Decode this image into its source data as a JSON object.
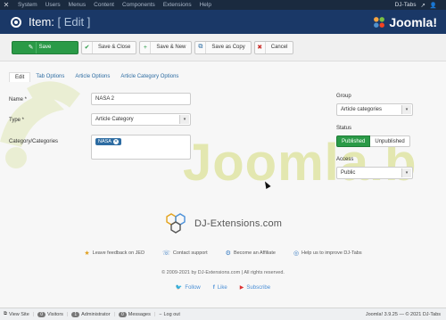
{
  "topnav": {
    "menu": [
      "System",
      "Users",
      "Menus",
      "Content",
      "Components",
      "Extensions",
      "Help"
    ],
    "site_name": "DJ-Tabs"
  },
  "titlebar": {
    "prefix": "Item:",
    "edit": "[ Edit ]",
    "brand": "Joomla!"
  },
  "toolbar": {
    "save": "Save",
    "save_close": "Save & Close",
    "save_new": "Save & New",
    "save_copy": "Save as Copy",
    "cancel": "Cancel"
  },
  "tabs": [
    "Edit",
    "Tab Options",
    "Article Options",
    "Article Category Options"
  ],
  "form": {
    "name_label": "Name *",
    "name_value": "NASA 2",
    "type_label": "Type *",
    "type_value": "Article Category",
    "categories_label": "Category/Categories",
    "category_chip": "NASA",
    "group_label": "Group",
    "group_value": "Article categories",
    "status_label": "Status",
    "status_on": "Published",
    "status_off": "Unpublished",
    "access_label": "Access",
    "access_value": "Public"
  },
  "watermark": "Joomla.b",
  "footer": {
    "dj_brand": "DJ-Extensions.com",
    "links": [
      "Leave feedback on JED",
      "Contact support",
      "Become an Affiliate",
      "Help us to improve DJ-Tabs"
    ],
    "copyright": "© 2009-2021 by DJ-Extensions.com | All rights reserved.",
    "social": [
      "Follow",
      "Like",
      "Subscribe"
    ]
  },
  "statusbar": {
    "view_site": "View Site",
    "visitors_count": "0",
    "visitors": "Visitors",
    "admin_count": "1",
    "admin": "Administrator",
    "messages_count": "0",
    "messages": "Messages",
    "logout": "Log out",
    "version": "Joomla! 3.9.25",
    "copyright": "— © 2021 DJ-Tabs"
  },
  "colors": {
    "header": "#1a3867",
    "topnav": "#1a2a3f",
    "save_green": "#2a9a47",
    "link_blue": "#2d6ca2"
  }
}
